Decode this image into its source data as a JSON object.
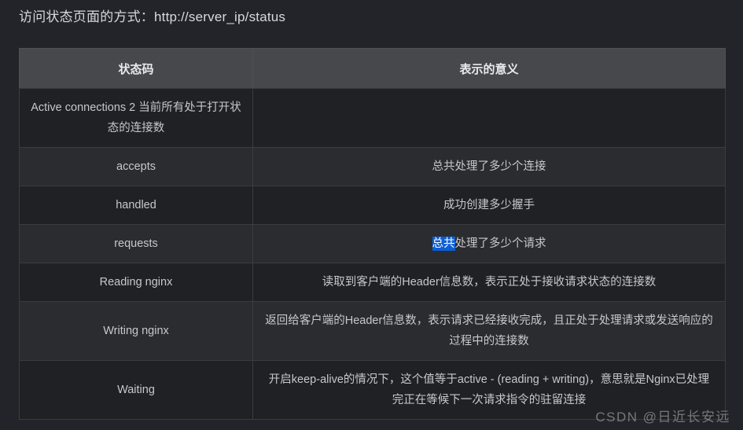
{
  "header": {
    "title_label": "访问状态页面的方式：",
    "title_url": "http://server_ip/status"
  },
  "table": {
    "columns": [
      "状态码",
      "表示的意义"
    ],
    "rows": [
      {
        "code": "Active connections 2 当前所有处于打开状态的连接数",
        "meaning": "",
        "meaning_pre": "",
        "meaning_sel": "",
        "meaning_post": ""
      },
      {
        "code": "accepts",
        "meaning": "总共处理了多少个连接",
        "meaning_pre": "总共处理了多少个连接",
        "meaning_sel": "",
        "meaning_post": ""
      },
      {
        "code": "handled",
        "meaning": "成功创建多少握手",
        "meaning_pre": "成功创建多少握手",
        "meaning_sel": "",
        "meaning_post": ""
      },
      {
        "code": "requests",
        "meaning": "总共处理了多少个请求",
        "meaning_pre": "",
        "meaning_sel": "总共",
        "meaning_post": "处理了多少个请求"
      },
      {
        "code": "Reading nginx",
        "meaning": "读取到客户端的Header信息数，表示正处于接收请求状态的连接数",
        "meaning_pre": "读取到客户端的Header信息数，表示正处于接收请求状态的连接数",
        "meaning_sel": "",
        "meaning_post": ""
      },
      {
        "code": "Writing nginx",
        "meaning": "返回给客户端的Header信息数，表示请求已经接收完成，且正处于处理请求或发送响应的过程中的连接数",
        "meaning_pre": "返回给客户端的Header信息数，表示请求已经接收完成，且正处于处理请求或发送响应的过程中的连接数",
        "meaning_sel": "",
        "meaning_post": ""
      },
      {
        "code": "Waiting",
        "meaning": "开启keep-alive的情况下，这个值等于active - (reading + writing)，意思就是Nginx已处理完正在等候下一次请求指令的驻留连接",
        "meaning_pre": "开启keep-alive的情况下，这个值等于active - (reading + writing)，意思就是Nginx已处理完正在等候下一次请求指令的驻留连接",
        "meaning_sel": "",
        "meaning_post": ""
      }
    ]
  },
  "watermark": {
    "text": "CSDN @日近长安远"
  },
  "colors": {
    "page_background": "#22242a",
    "table_header_background": "#46484c",
    "row_dark": "#202125",
    "row_light": "#2b2c30",
    "border": "#3a3c40",
    "text": "#c7c8cb",
    "selection_highlight": "#0b5ed7",
    "selection_text": "#ffffff"
  }
}
